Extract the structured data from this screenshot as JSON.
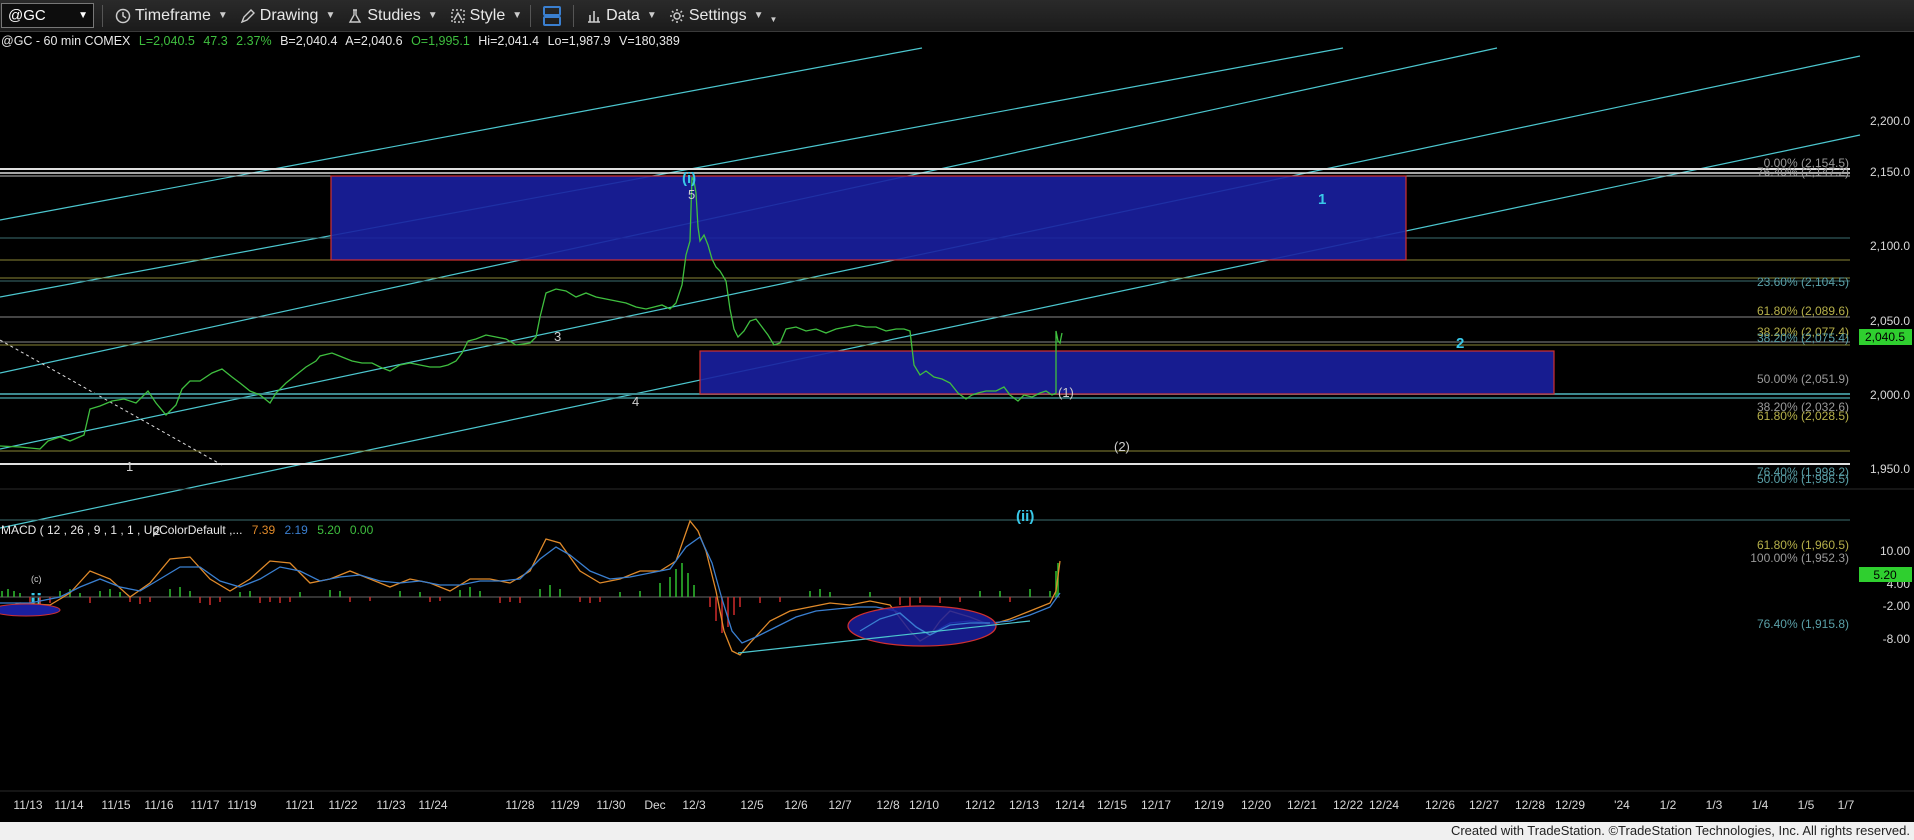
{
  "toolbar": {
    "symbol": "@GC",
    "timeframe_label": "Timeframe",
    "drawing_label": "Drawing",
    "studies_label": "Studies",
    "style_label": "Style",
    "data_label": "Data",
    "settings_label": "Settings"
  },
  "header": {
    "symbol_info": "@GC - 60 min  COMEX",
    "last": "L=2,040.5",
    "change": "47.3",
    "change_pct": "2.37%",
    "bid": "B=2,040.4",
    "ask": "A=2,040.6",
    "open": "O=1,995.1",
    "high": "Hi=2,041.4",
    "low": "Lo=1,987.9",
    "volume": "V=180,389"
  },
  "price_axis": [
    "2,200.0",
    "2,150.0",
    "2,100.0",
    "2,050.0",
    "2,000.0",
    "1,950.0"
  ],
  "last_price_badge": "2,040.5",
  "fib_labels": [
    {
      "text": "0.00% (2,154.5)",
      "price": 2154.5,
      "color": "#9a9a9a"
    },
    {
      "text": "76.40% (2,147.2)",
      "price": 2149.5,
      "color": "#9a9a9a"
    },
    {
      "text": "23.60% (2,104.5)",
      "price": 2104.5,
      "color": "#5aa0a8"
    },
    {
      "text": "61.80% (2,089.6)",
      "price": 2089.6,
      "color": "#b6b04a"
    },
    {
      "text": "38.20% (2,077.4)",
      "price": 2077.4,
      "color": "#b6b04a"
    },
    {
      "text": "38.20% (2,075.4)",
      "price": 2075.4,
      "color": "#5aa0a8"
    },
    {
      "text": "50.00% (2,051.9)",
      "price": 2051.9,
      "color": "#9a9a9a"
    },
    {
      "text": "38.20% (2,032.6)",
      "price": 2032.6,
      "color": "#9a9a9a"
    },
    {
      "text": "61.80% (2,028.5)",
      "price": 2028.5,
      "color": "#b6b04a"
    },
    {
      "text": "76.40% (1,998.2)",
      "price": 1998.2,
      "color": "#5aa0a8"
    },
    {
      "text": "50.00% (1,996.5)",
      "price": 1996.5,
      "color": "#5aa0a8"
    },
    {
      "text": "61.80% (1,960.5)",
      "price": 1960.5,
      "color": "#b6b04a"
    },
    {
      "text": "100.00% (1,952.3)",
      "price": 1952.3,
      "color": "#9a9a9a"
    },
    {
      "text": "76.40% (1,915.8)",
      "price": 1915.8,
      "color": "#5aa0a8"
    }
  ],
  "wave_labels": [
    {
      "text": "(i)",
      "color": "#39c8e8"
    },
    {
      "text": "5",
      "color": "#cfcfcf"
    },
    {
      "text": "3",
      "color": "#cfcfcf"
    },
    {
      "text": "4",
      "color": "#cfcfcf"
    },
    {
      "text": "1",
      "color": "#cfcfcf"
    },
    {
      "text": "2",
      "color": "#cfcfcf"
    },
    {
      "text": "(1)",
      "color": "#cfcfcf"
    },
    {
      "text": "(2)",
      "color": "#cfcfcf"
    },
    {
      "text": "(ii)",
      "color": "#39c8e8"
    },
    {
      "text": "1",
      "color": "#39c8e8"
    },
    {
      "text": "2",
      "color": "#39c8e8"
    },
    {
      "text": "ii",
      "color": "#39c8e8"
    },
    {
      "text": "(c)",
      "color": "#cfcfcf"
    }
  ],
  "macd": {
    "label": "MACD ( 12 , 26 , 9 , 1 , 1 , UpColorDefault ,...",
    "v1": "7.39",
    "v2": "2.19",
    "v3": "5.20",
    "v4": "0.00",
    "axis": [
      "10.00",
      "4.00",
      "-2.00",
      "-8.00"
    ],
    "badge": "5.20"
  },
  "date_axis": [
    "11/13",
    "11/14",
    "11/15",
    "11/16",
    "11/17",
    "11/19",
    "11/21",
    "11/22",
    "11/23",
    "11/24",
    "11/28",
    "11/29",
    "11/30",
    "Dec",
    "12/3",
    "12/5",
    "12/6",
    "12/7",
    "12/8",
    "12/10",
    "12/12",
    "12/13",
    "12/14",
    "12/15",
    "12/17",
    "12/19",
    "12/20",
    "12/21",
    "12/22",
    "12/24",
    "12/26",
    "12/27",
    "12/28",
    "12/29",
    "'24",
    "1/2",
    "1/3",
    "1/4",
    "1/5",
    "1/7"
  ],
  "footer": "Created with TradeStation. ©TradeStation Technologies, Inc. All rights reserved.",
  "colors": {
    "price_line": "#3fbf3f",
    "channel": "#4cc7cf",
    "box_fill": "#1a1fa0",
    "box_edge": "#d03030",
    "macd_fast": "#e08a2a",
    "macd_slow": "#3a7fd0",
    "hist_up": "#2fbf2f",
    "hist_down": "#d02a2a"
  }
}
